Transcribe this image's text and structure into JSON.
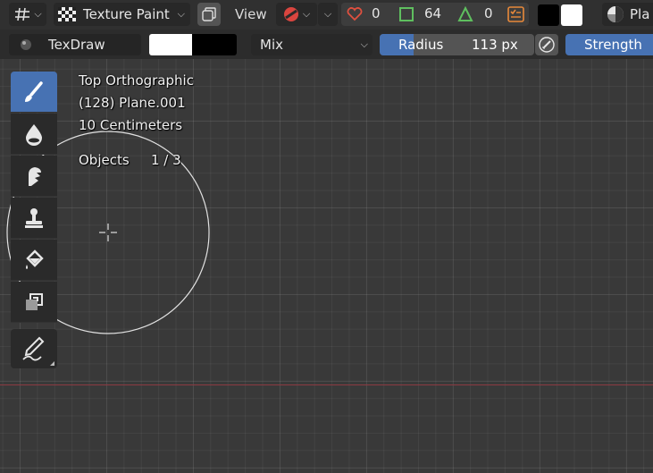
{
  "header": {
    "mode_label": "Texture Paint",
    "view_label": "View",
    "stat_faces": "0",
    "stat_verts": "64",
    "stat_tris": "0",
    "shading_label": "Pla"
  },
  "tool_settings": {
    "brush_name": "TexDraw",
    "blend_mode": "Mix",
    "radius_label": "Radius",
    "radius_value": "113 px",
    "strength_label": "Strength",
    "primary_color": "#ffffff",
    "secondary_color": "#000000"
  },
  "viewport": {
    "view_name": "Top Orthographic",
    "object_name": "(128) Plane.001",
    "scale": "10 Centimeters",
    "objects_label": "Objects",
    "objects_count": "1 / 3"
  },
  "toolbar": {
    "tools": [
      "brush-draw",
      "soften",
      "smear",
      "clone",
      "fill",
      "mask",
      "annotate"
    ],
    "active_tool": "brush-draw"
  },
  "colors": {
    "accent": "#4772b3",
    "x_axis": "#8c3a42",
    "viewport_bg": "#393939"
  }
}
